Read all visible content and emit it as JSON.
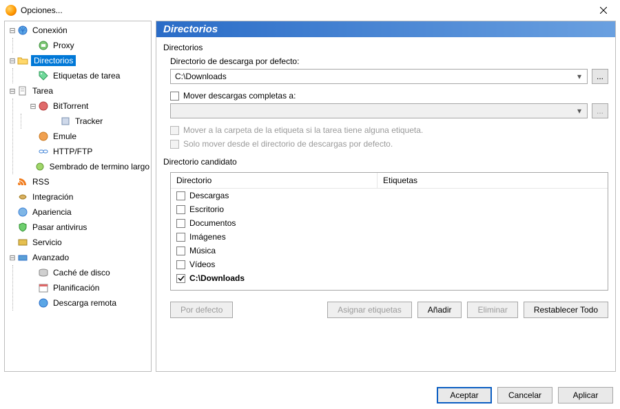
{
  "window": {
    "title": "Opciones..."
  },
  "tree": {
    "conexion": "Conexión",
    "proxy": "Proxy",
    "directorios": "Directorios",
    "etiquetas": "Etiquetas de tarea",
    "tarea": "Tarea",
    "bittorrent": "BitTorrent",
    "tracker": "Tracker",
    "emule": "Emule",
    "httpftp": "HTTP/FTP",
    "sembrado": "Sembrado de termino largo",
    "rss": "RSS",
    "integracion": "Integración",
    "apariencia": "Apariencia",
    "antivirus": "Pasar antivirus",
    "servicio": "Servicio",
    "avanzado": "Avanzado",
    "cache": "Caché de disco",
    "planificacion": "Planificación",
    "remota": "Descarga remota"
  },
  "panel": {
    "title": "Directorios",
    "group_directorios": "Directorios",
    "label_default": "Directorio de descarga por defecto:",
    "default_path": "C:\\Downloads",
    "browse": "...",
    "move_completed": "Mover descargas completas a:",
    "move_completed_path": "",
    "move_to_tag": "Mover a la carpeta de la etiqueta si la tarea tiene alguna etiqueta.",
    "only_move": "Solo mover desde el directorio de descargas por defecto.",
    "group_candidate": "Directorio candidato",
    "col_dir": "Directorio",
    "col_tags": "Etiquetas",
    "candidates": [
      {
        "label": "Descargas",
        "checked": false,
        "bold": false
      },
      {
        "label": "Escritorio",
        "checked": false,
        "bold": false
      },
      {
        "label": "Documentos",
        "checked": false,
        "bold": false
      },
      {
        "label": "Imágenes",
        "checked": false,
        "bold": false
      },
      {
        "label": "Música",
        "checked": false,
        "bold": false
      },
      {
        "label": "Vídeos",
        "checked": false,
        "bold": false
      },
      {
        "label": "C:\\Downloads",
        "checked": true,
        "bold": true
      }
    ],
    "buttons": {
      "default": "Por defecto",
      "assign": "Asignar etiquetas",
      "add": "Añadir",
      "delete": "Eliminar",
      "reset": "Restablecer Todo"
    }
  },
  "footer": {
    "ok": "Aceptar",
    "cancel": "Cancelar",
    "apply": "Aplicar"
  }
}
